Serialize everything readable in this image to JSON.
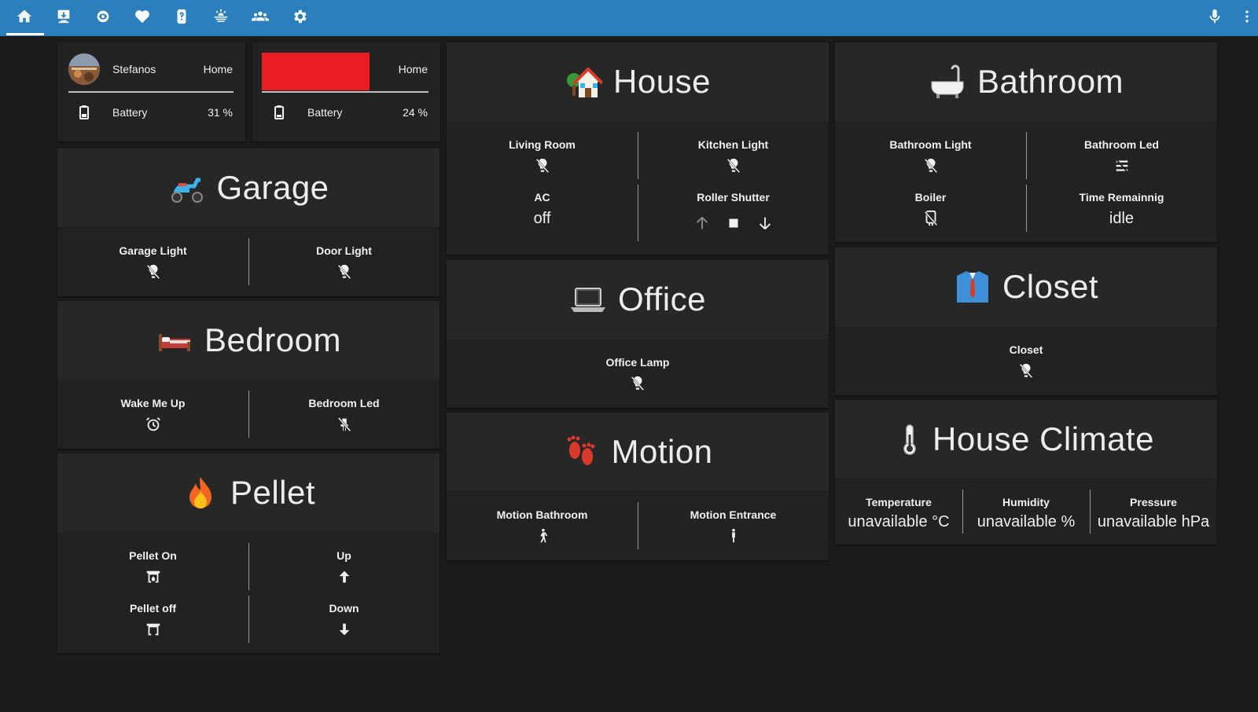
{
  "nav": {
    "icons": [
      "home-icon",
      "monitor-download-icon",
      "eye-icon",
      "heart-pulse-icon",
      "help-icon",
      "weather-icon",
      "account-group-icon",
      "settings-icon"
    ],
    "mic_icon": "microphone-icon",
    "menu_icon": "dots-vertical-icon",
    "accent": "#2c7fbd"
  },
  "people": [
    {
      "name": "Stefanos",
      "state": "Home",
      "battery_label": "Battery",
      "battery_value": "31 %"
    },
    {
      "name": "",
      "state": "Home",
      "battery_label": "Battery",
      "battery_value": "24 %",
      "redacted_color": "#ec1c24"
    }
  ],
  "garage": {
    "title": "Garage",
    "items": [
      "Garage Light",
      "Door Light"
    ]
  },
  "bedroom": {
    "title": "Bedroom",
    "items": [
      "Wake Me Up",
      "Bedroom Led"
    ]
  },
  "pellet": {
    "title": "Pellet",
    "items": [
      "Pellet On",
      "Up",
      "Pellet off",
      "Down"
    ]
  },
  "house": {
    "title": "House",
    "living_room": "Living Room",
    "kitchen_light": "Kitchen Light",
    "ac_label": "AC",
    "ac_value": "off",
    "roller_shutter": "Roller Shutter"
  },
  "office": {
    "title": "Office",
    "lamp": "Office Lamp"
  },
  "motion": {
    "title": "Motion",
    "items": [
      "Motion Bathroom",
      "Motion Entrance"
    ]
  },
  "bathroom": {
    "title": "Bathroom",
    "light": "Bathroom Light",
    "led": "Bathroom Led",
    "boiler": "Boiler",
    "time_label": "Time Remainnig",
    "time_value": "idle"
  },
  "closet": {
    "title": "Closet",
    "item": "Closet"
  },
  "climate": {
    "title": "House Climate",
    "temperature_label": "Temperature",
    "temperature_value": "unavailable °C",
    "humidity_label": "Humidity",
    "humidity_value": "unavailable %",
    "pressure_label": "Pressure",
    "pressure_value": "unavailable hPa"
  }
}
